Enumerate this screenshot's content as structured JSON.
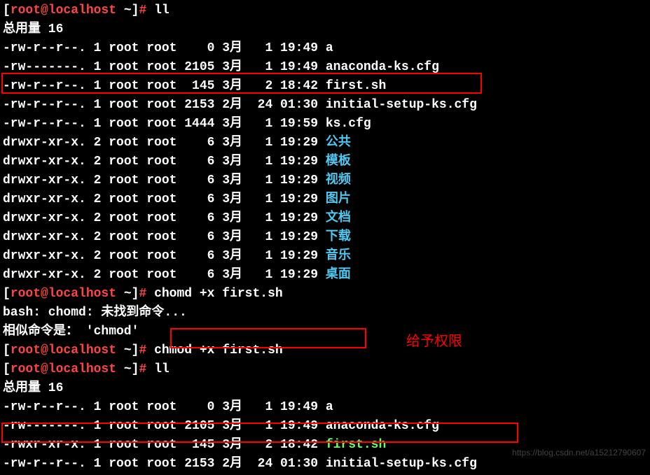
{
  "prompt1": {
    "user": "root",
    "at": "@",
    "host": "localhost",
    "dir": " ~",
    "hash": "# ",
    "cmd": "ll"
  },
  "total1": "总用量 16",
  "ls1": [
    {
      "perm": "-rw-r--r--. 1 root root    0 3月   1 19:49 ",
      "name": "a",
      "cls": "white"
    },
    {
      "perm": "-rw-------. 1 root root 2105 3月   1 19:49 ",
      "name": "anaconda-ks.cfg",
      "cls": "white"
    },
    {
      "perm": "-rw-r--r--. 1 root root  145 3月   2 18:42 ",
      "name": "first.sh",
      "cls": "white"
    },
    {
      "perm": "-rw-r--r--. 1 root root 2153 2月  24 01:30 ",
      "name": "initial-setup-ks.cfg",
      "cls": "white"
    },
    {
      "perm": "-rw-r--r--. 1 root root 1444 3月   1 19:59 ",
      "name": "ks.cfg",
      "cls": "white"
    },
    {
      "perm": "drwxr-xr-x. 2 root root    6 3月   1 19:29 ",
      "name": "公共",
      "cls": "cyan"
    },
    {
      "perm": "drwxr-xr-x. 2 root root    6 3月   1 19:29 ",
      "name": "模板",
      "cls": "cyan"
    },
    {
      "perm": "drwxr-xr-x. 2 root root    6 3月   1 19:29 ",
      "name": "视频",
      "cls": "cyan"
    },
    {
      "perm": "drwxr-xr-x. 2 root root    6 3月   1 19:29 ",
      "name": "图片",
      "cls": "cyan"
    },
    {
      "perm": "drwxr-xr-x. 2 root root    6 3月   1 19:29 ",
      "name": "文档",
      "cls": "cyan"
    },
    {
      "perm": "drwxr-xr-x. 2 root root    6 3月   1 19:29 ",
      "name": "下载",
      "cls": "cyan"
    },
    {
      "perm": "drwxr-xr-x. 2 root root    6 3月   1 19:29 ",
      "name": "音乐",
      "cls": "cyan"
    },
    {
      "perm": "drwxr-xr-x. 2 root root    6 3月   1 19:29 ",
      "name": "桌面",
      "cls": "cyan"
    }
  ],
  "prompt2": {
    "cmd": "chomd +x first.sh"
  },
  "err1": "bash: chomd: 未找到命令...",
  "err2": "相似命令是： 'chmod'",
  "prompt3": {
    "cmd": "chmod +x first.sh"
  },
  "prompt4": {
    "cmd": "ll"
  },
  "total2": "总用量 16",
  "ls2": [
    {
      "perm": "-rw-r--r--. 1 root root    0 3月   1 19:49 ",
      "name": "a",
      "cls": "white"
    },
    {
      "perm": "-rw-------. 1 root root 2105 3月   1 19:49 ",
      "name": "anaconda-ks.cfg",
      "cls": "white"
    },
    {
      "perm": "-rwxr-xr-x. 1 root root  145 3月   2 18:42 ",
      "name": "first.sh",
      "cls": "green"
    },
    {
      "perm": "-rw-r--r--. 1 root root 2153 2月  24 01:30 ",
      "name": "initial-setup-ks.cfg",
      "cls": "white"
    }
  ],
  "annot": "给予权限",
  "watermark": "https://blog.csdn.net/a15212790607"
}
